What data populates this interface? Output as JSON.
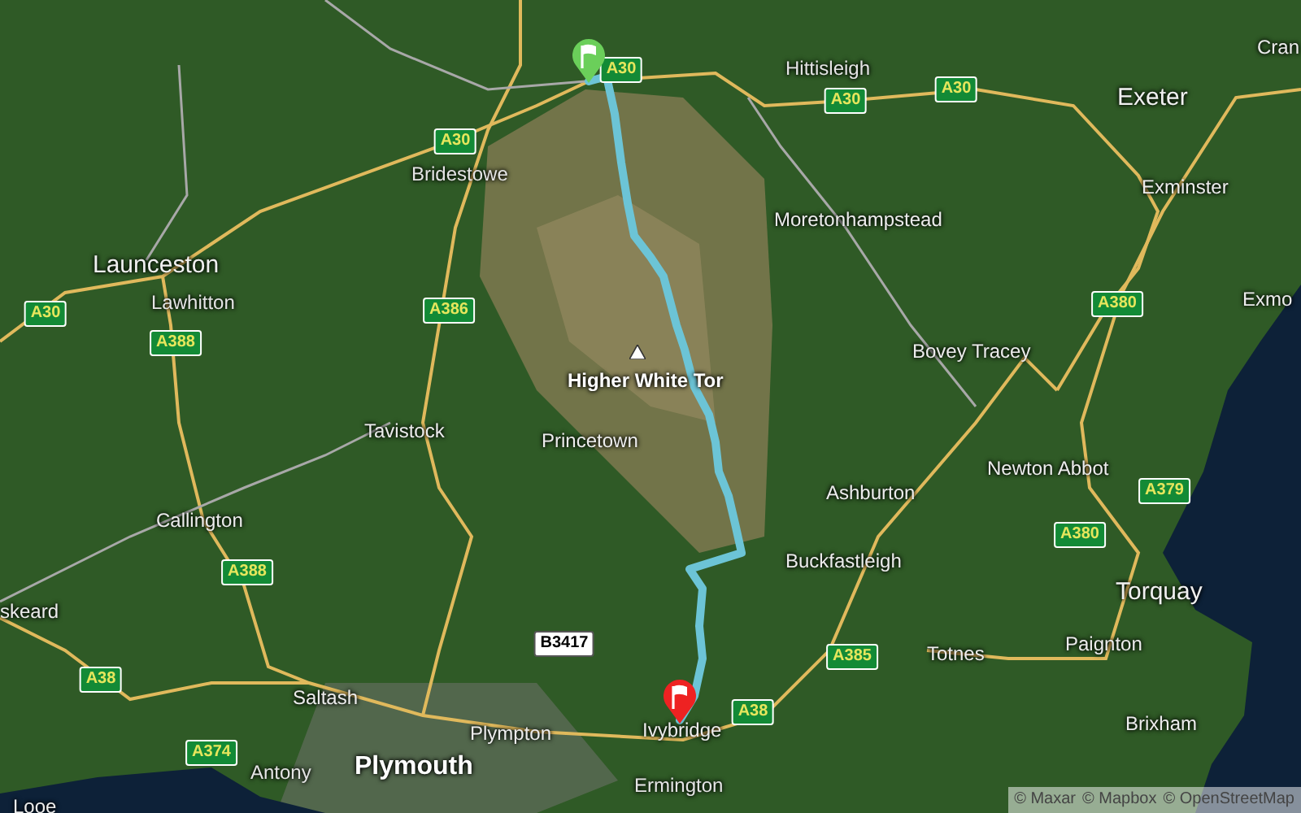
{
  "map": {
    "places": [
      {
        "name": "Hittisleigh",
        "kind": "village"
      },
      {
        "name": "Cran",
        "kind": "town"
      },
      {
        "name": "Exeter",
        "kind": "city"
      },
      {
        "name": "Bridestowe",
        "kind": "village"
      },
      {
        "name": "Exminster",
        "kind": "town"
      },
      {
        "name": "Moretonhampstead",
        "kind": "town"
      },
      {
        "name": "Launceston",
        "kind": "city"
      },
      {
        "name": "Lawhitton",
        "kind": "village"
      },
      {
        "name": "Exmo",
        "kind": "town"
      },
      {
        "name": "Bovey Tracey",
        "kind": "town"
      },
      {
        "name": "Higher White Tor",
        "kind": "peak"
      },
      {
        "name": "Tavistock",
        "kind": "town"
      },
      {
        "name": "Princetown",
        "kind": "town"
      },
      {
        "name": "Newton Abbot",
        "kind": "town"
      },
      {
        "name": "Ashburton",
        "kind": "town"
      },
      {
        "name": "Callington",
        "kind": "town"
      },
      {
        "name": "Buckfastleigh",
        "kind": "town"
      },
      {
        "name": "Torquay",
        "kind": "city"
      },
      {
        "name": "skeard",
        "kind": "town"
      },
      {
        "name": "Paignton",
        "kind": "town"
      },
      {
        "name": "Totnes",
        "kind": "town"
      },
      {
        "name": "Saltash",
        "kind": "town"
      },
      {
        "name": "Brixham",
        "kind": "town"
      },
      {
        "name": "Plympton",
        "kind": "town"
      },
      {
        "name": "Ivybridge",
        "kind": "town"
      },
      {
        "name": "Plymouth",
        "kind": "capital"
      },
      {
        "name": "Antony",
        "kind": "village"
      },
      {
        "name": "Ermington",
        "kind": "village"
      },
      {
        "name": "Looe",
        "kind": "town"
      }
    ],
    "road_shields": [
      {
        "label": "A30",
        "kind": "primary"
      },
      {
        "label": "A30",
        "kind": "primary"
      },
      {
        "label": "A30",
        "kind": "primary"
      },
      {
        "label": "A30",
        "kind": "primary"
      },
      {
        "label": "A30",
        "kind": "primary"
      },
      {
        "label": "A386",
        "kind": "primary"
      },
      {
        "label": "A388",
        "kind": "primary"
      },
      {
        "label": "A380",
        "kind": "primary"
      },
      {
        "label": "A379",
        "kind": "primary"
      },
      {
        "label": "A380",
        "kind": "primary"
      },
      {
        "label": "A388",
        "kind": "primary"
      },
      {
        "label": "B3417",
        "kind": "secondary"
      },
      {
        "label": "A385",
        "kind": "primary"
      },
      {
        "label": "A38",
        "kind": "primary"
      },
      {
        "label": "A38",
        "kind": "primary"
      },
      {
        "label": "A374",
        "kind": "primary"
      }
    ],
    "attribution": [
      "© Maxar",
      "© Mapbox",
      "© OpenStreetMap"
    ]
  }
}
